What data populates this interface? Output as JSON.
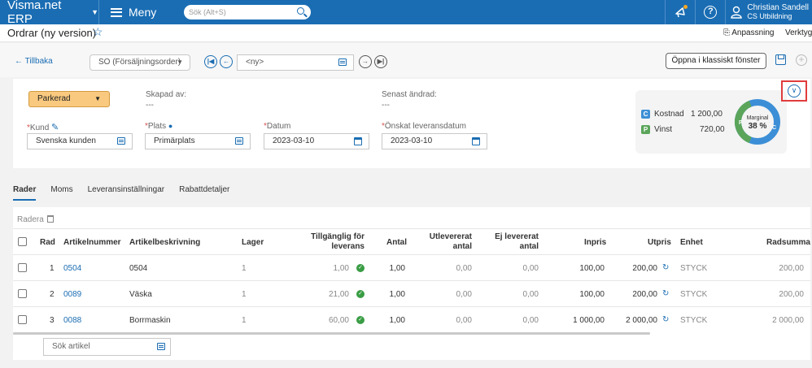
{
  "topbar": {
    "brand": "Visma.net ERP",
    "menu_label": "Meny",
    "search_placeholder": "Sök (Alt+S)",
    "user_name": "Christian Sandell",
    "user_company": "CS Utbildning"
  },
  "page": {
    "title": "Ordrar (ny version)",
    "anpassning": "Anpassning",
    "verktyg": "Verktyg"
  },
  "commands": {
    "back": "Tillbaka",
    "order_type": "SO (Försäljningsorder)",
    "order_number": "<ny>",
    "open_classic": "Öppna i klassiskt fönster"
  },
  "header": {
    "status": "Parkerad",
    "created_by_label": "Skapad av:",
    "created_by_value": "---",
    "changed_label": "Senast ändrad:",
    "changed_value": "---",
    "customer_label": "Kund",
    "customer_value": "Svenska kunden",
    "site_label": "Plats",
    "site_value": "Primärplats",
    "date_label": "Datum",
    "date_value": "2023-03-10",
    "delivery_label": "Önskat leveransdatum",
    "delivery_value": "2023-03-10"
  },
  "summary": {
    "cost_badge": "C",
    "cost_label": "Kostnad",
    "cost_value": "1 200,00",
    "profit_badge": "P",
    "profit_label": "Vinst",
    "profit_value": "720,00",
    "margin_label": "Marginal",
    "margin_value": "38 %",
    "margin_fraction": 0.38,
    "colors": {
      "cost": "#3c8fd6",
      "profit": "#5ba55b"
    }
  },
  "tabs": [
    "Rader",
    "Moms",
    "Leveransinställningar",
    "Rabattdetaljer"
  ],
  "grid": {
    "delete_label": "Radera",
    "columns": {
      "rad": "Rad",
      "artnr": "Artikelnummer",
      "desc": "Artikelbeskrivning",
      "lager": "Lager",
      "avail": "Tillgänglig för leverans",
      "antal": "Antal",
      "utlev": "Utlevererat antal",
      "ejlev": "Ej levererat antal",
      "inpris": "Inpris",
      "utpris": "Utpris",
      "enhet": "Enhet",
      "radsumma": "Radsumma"
    },
    "rows": [
      {
        "rad": "1",
        "artnr": "0504",
        "desc": "0504",
        "lager": "1",
        "avail": "1,00",
        "antal": "1,00",
        "utlev": "0,00",
        "ejlev": "0,00",
        "inpris": "100,00",
        "utpris": "200,00",
        "enhet": "STYCK",
        "radsumma": "200,00"
      },
      {
        "rad": "2",
        "artnr": "0089",
        "desc": "Väska",
        "lager": "1",
        "avail": "21,00",
        "antal": "1,00",
        "utlev": "0,00",
        "ejlev": "0,00",
        "inpris": "100,00",
        "utpris": "200,00",
        "enhet": "STYCK",
        "radsumma": "200,00"
      },
      {
        "rad": "3",
        "artnr": "0088",
        "desc": "Borrmaskin",
        "lager": "1",
        "avail": "60,00",
        "antal": "1,00",
        "utlev": "0,00",
        "ejlev": "0,00",
        "inpris": "1 000,00",
        "utpris": "2 000,00",
        "enhet": "STYCK",
        "radsumma": "2 000,00"
      }
    ],
    "add_article_placeholder": "Sök artikel"
  }
}
